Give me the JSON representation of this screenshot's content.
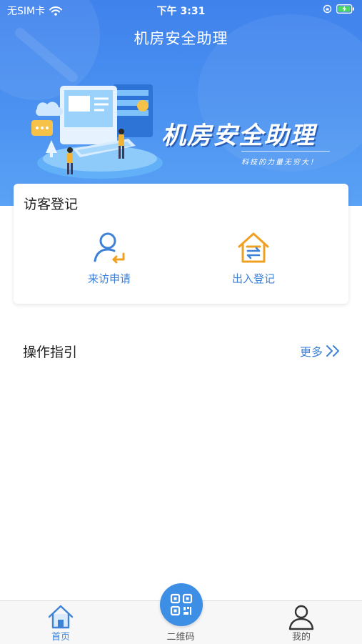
{
  "status_bar": {
    "carrier": "无SIM卡",
    "time": "下午 3:31"
  },
  "header": {
    "title": "机房安全助理",
    "banner_headline": "机房安全助理",
    "banner_slogan": "科技的力量无穷大！"
  },
  "visitor": {
    "title": "访客登记",
    "actions": [
      {
        "label": "来访申请",
        "icon": "user-return-icon"
      },
      {
        "label": "出入登记",
        "icon": "house-exchange-icon"
      }
    ]
  },
  "guide": {
    "title": "操作指引",
    "more_label": "更多"
  },
  "tabbar": {
    "items": [
      {
        "label": "首页",
        "icon": "home-icon",
        "active": true
      },
      {
        "label": "二维码",
        "icon": "qr-code-icon",
        "active": false
      },
      {
        "label": "我的",
        "icon": "user-icon",
        "active": false
      }
    ]
  },
  "colors": {
    "header_blue": "#4a8ef0",
    "accent_blue": "#3d82d6",
    "house_orange": "#f0a020",
    "qr_button": "#3d8fe6"
  }
}
